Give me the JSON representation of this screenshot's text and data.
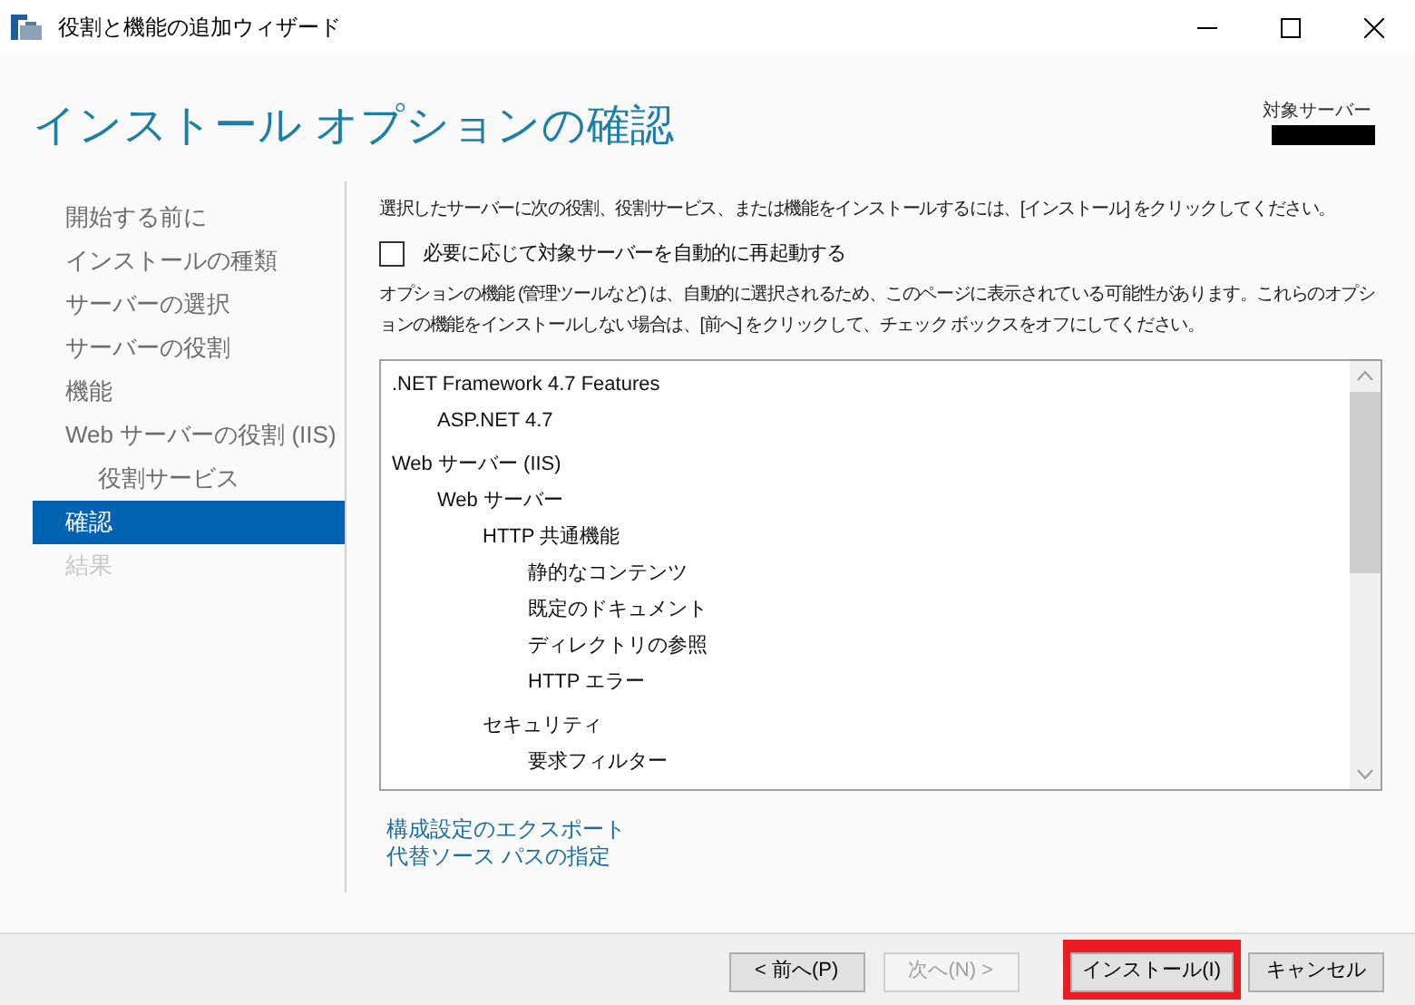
{
  "window": {
    "title": "役割と機能の追加ウィザード"
  },
  "header": {
    "title": "インストール オプションの確認",
    "target_label": "対象サーバー"
  },
  "sidebar": {
    "items": [
      {
        "label": "開始する前に",
        "selected": false,
        "disabled": false
      },
      {
        "label": "インストールの種類",
        "selected": false,
        "disabled": false
      },
      {
        "label": "サーバーの選択",
        "selected": false,
        "disabled": false
      },
      {
        "label": "サーバーの役割",
        "selected": false,
        "disabled": false
      },
      {
        "label": "機能",
        "selected": false,
        "disabled": false
      },
      {
        "label": "Web サーバーの役割 (IIS)",
        "selected": false,
        "disabled": false,
        "children": [
          {
            "label": "役割サービス",
            "selected": false,
            "disabled": false
          }
        ]
      },
      {
        "label": "確認",
        "selected": true,
        "disabled": false
      },
      {
        "label": "結果",
        "selected": false,
        "disabled": true
      }
    ]
  },
  "intro": "選択したサーバーに次の役割、役割サービス、または機能をインストールするには、[インストール] をクリックしてください。",
  "restart": {
    "label": "必要に応じて対象サーバーを自動的に再起動する",
    "checked": false
  },
  "note": "オプションの機能 (管理ツールなど) は、自動的に選択されるため、このページに表示されている可能性があります。これらのオプションの機能をインストールしない場合は、[前へ] をクリックして、チェック ボックスをオフにしてください。",
  "features": [
    {
      "label": ".NET Framework 4.7 Features",
      "children": [
        {
          "label": "ASP.NET 4.7"
        }
      ]
    },
    {
      "label": "Web サーバー (IIS)",
      "children": [
        {
          "label": "Web サーバー",
          "children": [
            {
              "label": "HTTP 共通機能",
              "children": [
                {
                  "label": "静的なコンテンツ"
                },
                {
                  "label": "既定のドキュメント"
                },
                {
                  "label": "ディレクトリの参照"
                },
                {
                  "label": "HTTP エラー"
                }
              ]
            },
            {
              "label": "セキュリティ",
              "children": [
                {
                  "label": "要求フィルター"
                }
              ]
            }
          ]
        }
      ]
    }
  ],
  "links": [
    "構成設定のエクスポート",
    "代替ソース パスの指定"
  ],
  "buttons": [
    {
      "label": "< 前へ(P)",
      "disabled": false,
      "highlighted": false
    },
    {
      "label": "次へ(N) >",
      "disabled": true,
      "highlighted": false
    },
    {
      "label": "インストール(I)",
      "disabled": false,
      "highlighted": true
    },
    {
      "label": "キャンセル",
      "disabled": false,
      "highlighted": false
    }
  ]
}
